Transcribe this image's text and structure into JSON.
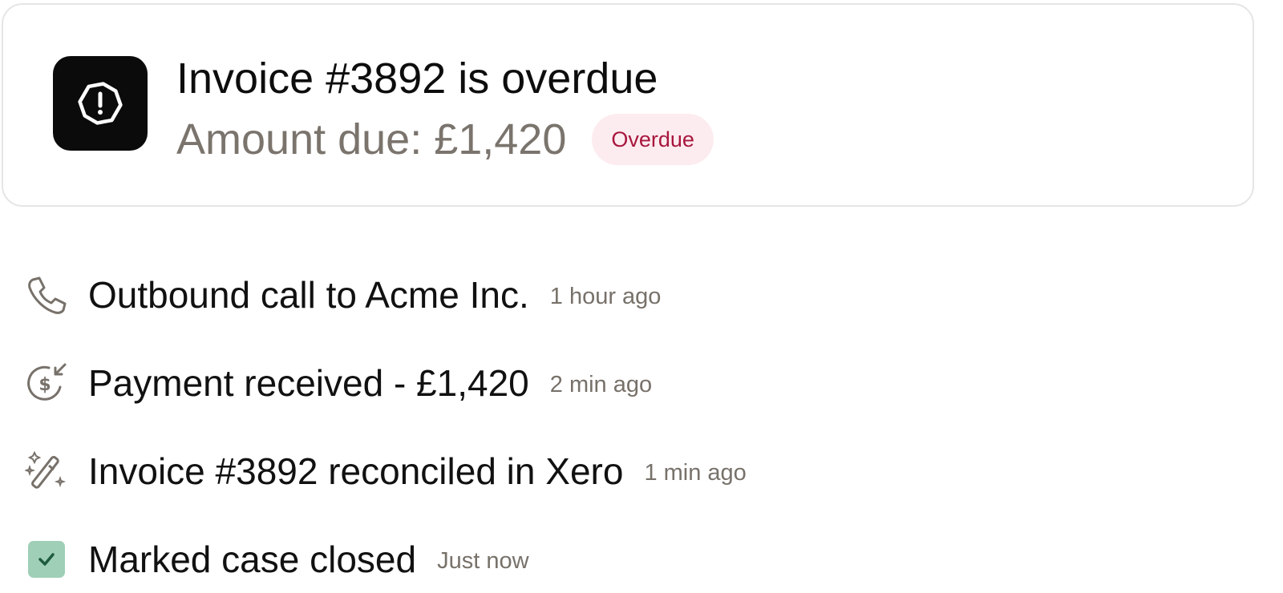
{
  "alert": {
    "icon": "hexagon-alert-icon",
    "title": "Invoice #3892 is overdue",
    "amount": "Amount due: £1,420",
    "badge": "Overdue",
    "badge_bg": "#fdecef",
    "badge_color": "#a8173e"
  },
  "activities": [
    {
      "icon": "phone-icon",
      "text": "Outbound call to Acme Inc.",
      "time": "1 hour ago"
    },
    {
      "icon": "payment-received-icon",
      "text": "Payment received - £1,420",
      "time": "2 min ago"
    },
    {
      "icon": "magic-wand-icon",
      "text": "Invoice #3892 reconciled in Xero",
      "time": "1 min ago"
    },
    {
      "icon": "checked-box-icon",
      "text": "Marked case closed",
      "time": "Just now"
    }
  ],
  "colors": {
    "check_green": "#9fcfb7",
    "check_mark": "#1f5c3f",
    "muted_icon": "#77716a"
  }
}
